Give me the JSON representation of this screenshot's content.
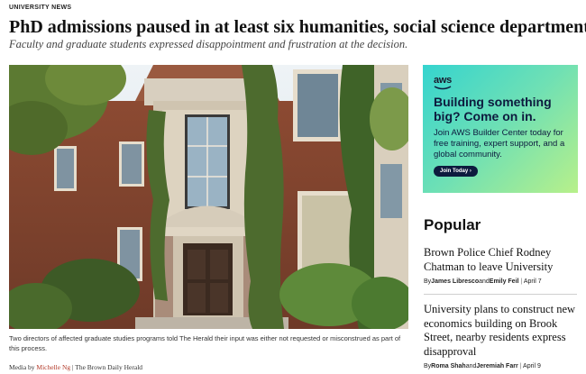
{
  "article": {
    "category": "UNIVERSITY NEWS",
    "headline": "PhD admissions paused in at least six humanities, social science departments",
    "subheadline": "Faculty and graduate students expressed disappointment and frustration at the decision.",
    "caption": "Two directors of affected graduate studies programs told The Herald their input was either not requested or misconstrued as part of this process.",
    "credit": {
      "prefix": "Media by",
      "author": "Michelle Ng",
      "separator": "|",
      "source": "The Brown Daily Herald"
    }
  },
  "ad": {
    "logo": "aws",
    "headline": "Building something big? Come on in.",
    "body": "Join AWS Builder Center today for free training, expert support, and a global community.",
    "button": "Join Today ›",
    "colors": {
      "gradient_start": "#35d4cf",
      "gradient_end": "#b8f08a",
      "text": "#0d1b3e"
    }
  },
  "popular": {
    "title": "Popular",
    "items": [
      {
        "headline": "Brown Police Chief Rodney Chatman to leave University",
        "by": "By",
        "author1": "James Libresco",
        "and": "and",
        "author2": "Emily Feil",
        "separator": "|",
        "date": "April 7"
      },
      {
        "headline": "University plans to construct new economics building on Brook Street, nearby residents express disapproval",
        "by": "By",
        "author1": "Roma Shah",
        "and": "and",
        "author2": "Jeremiah Farr",
        "separator": "|",
        "date": "April 9"
      }
    ]
  },
  "colors": {
    "link": "#b33a2a",
    "divider": "#cfcfcf"
  }
}
